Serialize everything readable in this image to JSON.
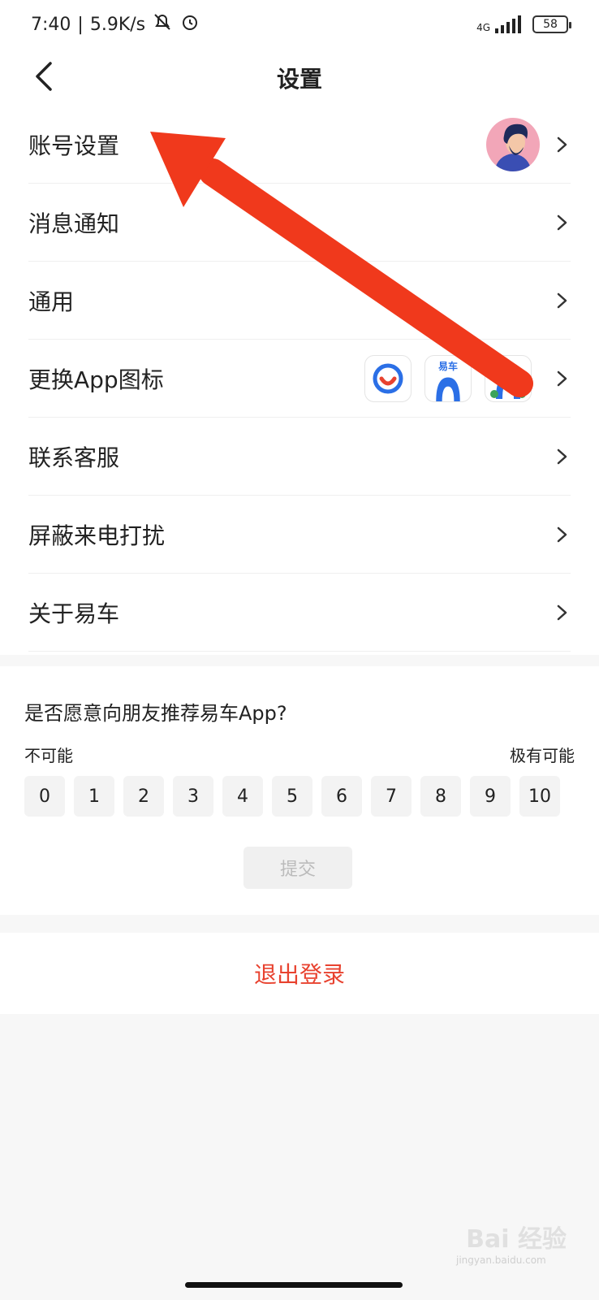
{
  "status_bar": {
    "time": "7:40",
    "network_speed": "5.9K/s",
    "signal_type": "4G",
    "battery": "58",
    "icons": [
      "mute-icon",
      "alarm-icon",
      "signal-icon",
      "battery-icon"
    ]
  },
  "header": {
    "title": "设置",
    "back_icon": "chevron-left-icon"
  },
  "settings": {
    "items": [
      {
        "label": "账号设置",
        "extra": "avatar"
      },
      {
        "label": "消息通知"
      },
      {
        "label": "通用"
      },
      {
        "label": "更换App图标",
        "extra": "app-icons"
      },
      {
        "label": "联系客服"
      },
      {
        "label": "屏蔽来电打扰"
      },
      {
        "label": "关于易车"
      }
    ],
    "app_icon_text": "易车"
  },
  "survey": {
    "question": "是否愿意向朋友推荐易车App?",
    "low_label": "不可能",
    "high_label": "极有可能",
    "scores": [
      "0",
      "1",
      "2",
      "3",
      "4",
      "5",
      "6",
      "7",
      "8",
      "9",
      "10"
    ],
    "submit_label": "提交"
  },
  "logout": {
    "label": "退出登录"
  },
  "watermark": {
    "text": "Bai 经验",
    "sub": "jingyan.baidu.com"
  },
  "colors": {
    "accent": "#e8422f",
    "annotation_arrow": "#f0391c"
  }
}
